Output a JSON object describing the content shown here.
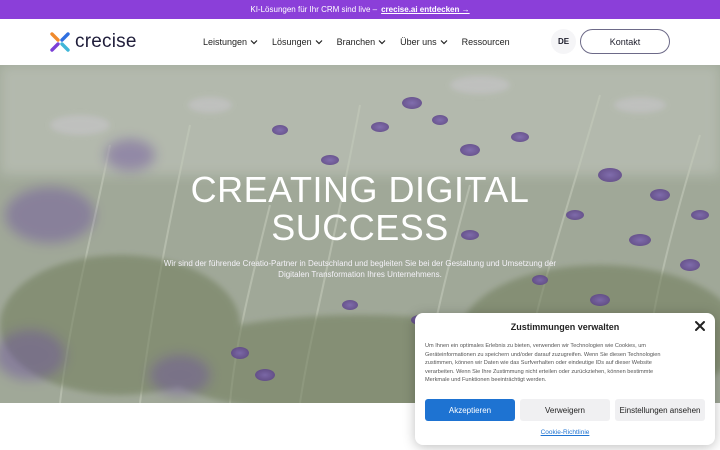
{
  "announcement": {
    "text": "KI-Lösungen für Ihr CRM sind live –",
    "link": "crecise.ai entdecken →"
  },
  "header": {
    "logo_text": "crecise",
    "nav": [
      {
        "label": "Leistungen",
        "has_dropdown": true
      },
      {
        "label": "Lösungen",
        "has_dropdown": true
      },
      {
        "label": "Branchen",
        "has_dropdown": true
      },
      {
        "label": "Über uns",
        "has_dropdown": true
      },
      {
        "label": "Ressourcen",
        "has_dropdown": false
      }
    ],
    "language": "DE",
    "contact_label": "Kontakt"
  },
  "hero": {
    "title_line1": "CREATING DIGITAL",
    "title_line2": "SUCCESS",
    "subtitle": "Wir sind der führende Creatio-Partner in Deutschland und begleiten Sie bei der Gestaltung und Umsetzung der Digitalen Transformation Ihres Unternehmens."
  },
  "cookie_dialog": {
    "title": "Zustimmungen verwalten",
    "text": "Um Ihnen ein optimales Erlebnis zu bieten, verwenden wir Technologien wie Cookies, um Geräteinformationen zu speichern und/oder darauf zuzugreifen. Wenn Sie diesen Technologien zustimmen, können wir Daten wie das Surfverhalten oder eindeutige IDs auf dieser Website verarbeiten. Wenn Sie Ihre Zustimmung nicht erteilen oder zurückziehen, können bestimmte Merkmale und Funktionen beeinträchtigt werden.",
    "accept_label": "Akzeptieren",
    "deny_label": "Verweigern",
    "settings_label": "Einstellungen ansehen",
    "policy_link": "Cookie-Richtlinie"
  },
  "colors": {
    "announcement_bg": "#8b3fd9",
    "accept_button": "#1e73d2",
    "logo_orange": "#f08a2c",
    "logo_purple": "#7b3fd6",
    "logo_blue": "#2f6fe0"
  },
  "icons": {
    "logo": "crecise-x-logo-icon",
    "chevron": "chevron-down-icon",
    "close": "close-icon"
  }
}
